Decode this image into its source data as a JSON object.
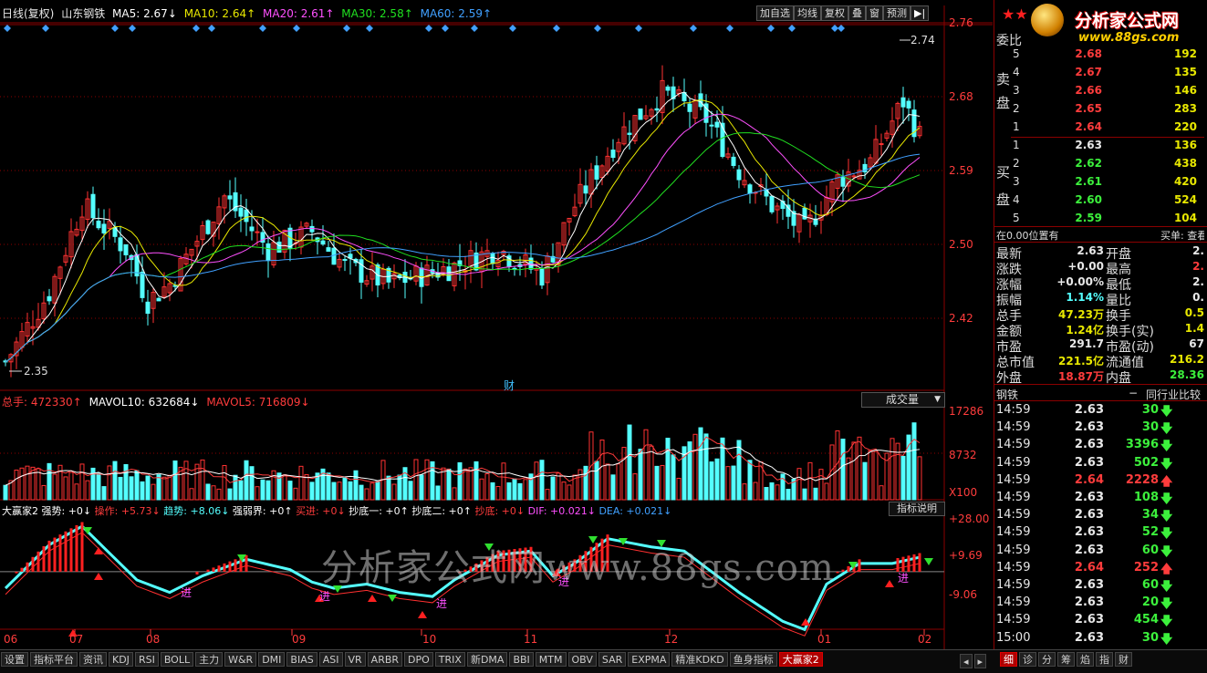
{
  "header": {
    "period": "日线(复权)",
    "stock": "山东钢铁",
    "ma5": "MA5: 2.67↓",
    "ma10": "MA10: 2.64↑",
    "ma20": "MA20: 2.61↑",
    "ma30": "MA30: 2.58↑",
    "ma60": "MA60: 2.59↑",
    "buttons": [
      "加自选",
      "均线",
      "复权",
      "叠",
      "窗",
      "预测"
    ],
    "play": "▶|"
  },
  "main_axis": [
    "2.76",
    "2.68",
    "2.59",
    "2.50",
    "2.42"
  ],
  "high_label": "2.74",
  "low_label": "2.35",
  "fin_marker": "财",
  "vol": {
    "total": "总手: 472330↑",
    "mavol10": "MAVOL10: 632684↓",
    "mavol5": "MAVOL5: 716809↓",
    "dropdown": "成交量",
    "axis": [
      "17286",
      "8732",
      "X100"
    ]
  },
  "ind": {
    "name": "大赢家2",
    "qs": "强势: +0↓",
    "cz": "操作: +5.73↓",
    "trend": "趋势: +8.06↓",
    "qrj": "强弱界: +0↑",
    "buy": "买进: +0↓",
    "cd1": "抄底一: +0↑",
    "cd2": "抄底二: +0↑",
    "cd": "抄底: +0↓",
    "dif": "DIF: +0.021↓",
    "dea": "DEA: +0.021↓",
    "explain": "指标说明",
    "axis": [
      "+28.00",
      "+9.69",
      "-9.06"
    ],
    "jin": "进"
  },
  "xaxis": [
    "06",
    "07",
    "08",
    "09",
    "10",
    "11",
    "12",
    "01",
    "02"
  ],
  "watermark": "分析家公式网www.88gs.com",
  "logo": {
    "title": "分析家公式网",
    "url": "www.88gs.com"
  },
  "orderbook": {
    "header": "委比",
    "sell_label": [
      "卖",
      "盘"
    ],
    "buy_label": [
      "买",
      "盘"
    ],
    "sells": [
      {
        "n": "5",
        "p": "2.68",
        "v": "192"
      },
      {
        "n": "4",
        "p": "2.67",
        "v": "135"
      },
      {
        "n": "3",
        "p": "2.66",
        "v": "146"
      },
      {
        "n": "2",
        "p": "2.65",
        "v": "283"
      },
      {
        "n": "1",
        "p": "2.64",
        "v": "220"
      }
    ],
    "buys": [
      {
        "n": "1",
        "p": "2.63",
        "v": "136"
      },
      {
        "n": "2",
        "p": "2.62",
        "v": "438"
      },
      {
        "n": "3",
        "p": "2.61",
        "v": "420"
      },
      {
        "n": "4",
        "p": "2.60",
        "v": "524"
      },
      {
        "n": "5",
        "p": "2.59",
        "v": "104"
      }
    ],
    "pos": "在0.00位置有",
    "buyorder": "买单: 查看详"
  },
  "quote": [
    {
      "k": "最新",
      "v": "2.63",
      "k2": "开盘",
      "v2": "2."
    },
    {
      "k": "涨跌",
      "v": "+0.00",
      "k2": "最高",
      "v2": "2."
    },
    {
      "k": "涨幅",
      "v": "+0.00%",
      "k2": "最低",
      "v2": "2."
    },
    {
      "k": "振幅",
      "v": "1.14%",
      "k2": "量比",
      "v2": "0."
    },
    {
      "k": "总手",
      "v": "47.23万",
      "k2": "换手",
      "v2": "0.5"
    },
    {
      "k": "金额",
      "v": "1.24亿",
      "k2": "换手(实)",
      "v2": "1.4"
    },
    {
      "k": "市盈",
      "v": "291.7",
      "k2": "市盈(动)",
      "v2": "67"
    },
    {
      "k": "总市值",
      "v": "221.5亿",
      "k2": "流通值",
      "v2": "216.2"
    },
    {
      "k": "外盘",
      "v": "18.87万",
      "k2": "内盘",
      "v2": "28.36"
    }
  ],
  "ticks_header": {
    "a": "钢铁",
    "b": "−",
    "c": "同行业比较"
  },
  "ticks": [
    {
      "t": "14:59",
      "p": "2.63",
      "v": "30",
      "d": "down"
    },
    {
      "t": "14:59",
      "p": "2.63",
      "v": "30",
      "d": "down"
    },
    {
      "t": "14:59",
      "p": "2.63",
      "v": "3396",
      "d": "down"
    },
    {
      "t": "14:59",
      "p": "2.63",
      "v": "502",
      "d": "down"
    },
    {
      "t": "14:59",
      "p": "2.64",
      "v": "2228",
      "d": "up"
    },
    {
      "t": "14:59",
      "p": "2.63",
      "v": "108",
      "d": "down"
    },
    {
      "t": "14:59",
      "p": "2.63",
      "v": "34",
      "d": "down"
    },
    {
      "t": "14:59",
      "p": "2.63",
      "v": "52",
      "d": "down"
    },
    {
      "t": "14:59",
      "p": "2.63",
      "v": "60",
      "d": "down"
    },
    {
      "t": "14:59",
      "p": "2.64",
      "v": "252",
      "d": "up"
    },
    {
      "t": "14:59",
      "p": "2.63",
      "v": "60",
      "d": "down"
    },
    {
      "t": "14:59",
      "p": "2.63",
      "v": "20",
      "d": "down"
    },
    {
      "t": "14:59",
      "p": "2.63",
      "v": "454",
      "d": "down"
    },
    {
      "t": "15:00",
      "p": "2.63",
      "v": "30",
      "d": "down"
    }
  ],
  "tabs": [
    "设置",
    "指标平台",
    "资讯",
    "KDJ",
    "RSI",
    "BOLL",
    "主力",
    "W&R",
    "DMI",
    "BIAS",
    "ASI",
    "VR",
    "ARBR",
    "DPO",
    "TRIX",
    "新DMA",
    "BBI",
    "MTM",
    "OBV",
    "SAR",
    "EXPMA",
    "精准KDKD",
    "鱼身指标",
    "大赢家2"
  ],
  "right_tabs": [
    "细",
    "诊",
    "分",
    "筹",
    "焰",
    "指",
    "财"
  ],
  "colors": {
    "up": "#ff3232",
    "down": "#54ffff",
    "grid": "#8b0000",
    "ma5": "#ffffff",
    "ma10": "#e8e800",
    "ma20": "#ff50ff",
    "ma30": "#20e020",
    "ma60": "#40a0ff"
  }
}
